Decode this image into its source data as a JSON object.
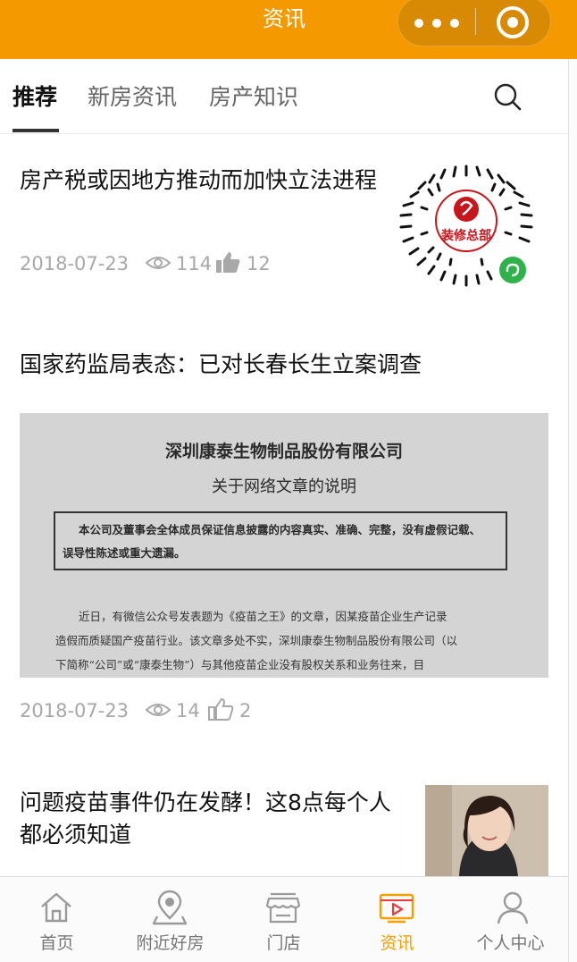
{
  "header": {
    "title": "资讯"
  },
  "tabs": [
    {
      "label": "推荐",
      "active": true
    },
    {
      "label": "新房资讯",
      "active": false
    },
    {
      "label": "房产知识",
      "active": false
    }
  ],
  "articles": [
    {
      "title": "房产税或因地方推动而加快立法进程",
      "date": "2018-07-23",
      "views": "114",
      "likes": "12",
      "qr_label": "装修总部"
    },
    {
      "title": "国家药监局表态：已对长春长生立案调查",
      "date": "2018-07-23",
      "views": "14",
      "likes": "2",
      "image_text": {
        "line1": "深圳康泰生物制品股份有限公司",
        "line2": "关于网络文章的说明",
        "box_line1": "本公司及董事会全体成员保证信息披露的内容真实、准确、完整，没有虚假记载、",
        "box_line2": "误导性陈述或重大遗漏。",
        "body_line1": "近日，有微信公众号发表题为《疫苗之王》的文章，因某疫苗企业生产记录",
        "body_line2": "造假而质疑国产疫苗行业。该文章多处不实，深圳康泰生物制品股份有限公司（以",
        "body_line3": "下简称“公司”或“康泰生物”）与其他疫苗企业没有股权关系和业务往来，目"
      }
    },
    {
      "title_line1": "问题疫苗事件仍在发酵！这8点每个人",
      "title_line2": "都必须知道"
    }
  ],
  "bottom_nav": [
    {
      "label": "首页",
      "icon": "home-icon",
      "active": false
    },
    {
      "label": "附近好房",
      "icon": "location-icon",
      "active": false
    },
    {
      "label": "门店",
      "icon": "store-icon",
      "active": false
    },
    {
      "label": "资讯",
      "icon": "news-icon",
      "active": true
    },
    {
      "label": "个人中心",
      "icon": "user-icon",
      "active": false
    }
  ],
  "colors": {
    "brand": "#f49a00",
    "active_nav": "#f4a000"
  }
}
